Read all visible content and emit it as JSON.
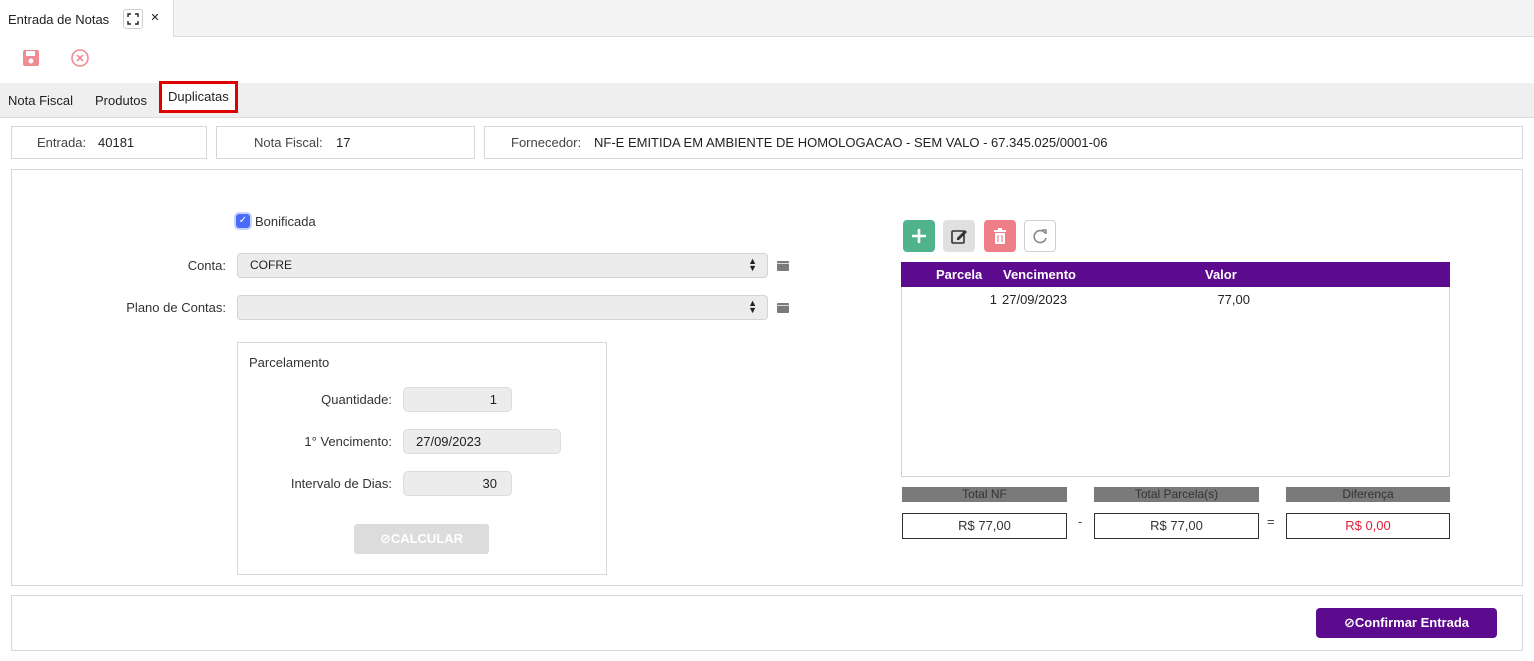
{
  "window_tab": {
    "title": "Entrada de Notas",
    "expand_glyph": "⛶",
    "close_glyph": "✕"
  },
  "toolbar": {
    "save_icon": "save-icon",
    "cancel_icon": "cancel-circle-icon"
  },
  "tabs": [
    {
      "label": "Nota Fiscal",
      "active": false
    },
    {
      "label": "Produtos",
      "active": false
    },
    {
      "label": "Duplicatas",
      "active": true
    }
  ],
  "header": {
    "entrada_label": "Entrada:",
    "entrada_value": "40181",
    "nota_label": "Nota Fiscal:",
    "nota_value": "17",
    "fornecedor_label": "Fornecedor:",
    "fornecedor_value": "NF-E EMITIDA EM AMBIENTE DE HOMOLOGACAO - SEM VALO - 67.345.025/0001-06"
  },
  "form": {
    "bonificada_label": "Bonificada",
    "bonificada_checked": true,
    "conta_label": "Conta:",
    "conta_value": "COFRE",
    "plano_label": "Plano de Contas:",
    "plano_value": ""
  },
  "parcelamento": {
    "title": "Parcelamento",
    "quantidade_label": "Quantidade:",
    "quantidade_value": "1",
    "vencimento_label": "1° Vencimento:",
    "vencimento_value": "27/09/2023",
    "intervalo_label": "Intervalo de Dias:",
    "intervalo_value": "30",
    "calcular_label": "⊘CALCULAR"
  },
  "grid": {
    "columns": [
      "Parcela",
      "Vencimento",
      "Valor"
    ],
    "rows": [
      {
        "parcela": "1",
        "vencimento": "27/09/2023",
        "valor": "77,00"
      }
    ]
  },
  "totals": {
    "total_nf_label": "Total NF",
    "total_nf_value": "R$ 77,00",
    "minus": "-",
    "total_parcelas_label": "Total Parcela(s)",
    "total_parcelas_value": "R$ 77,00",
    "equals": "=",
    "diferenca_label": "Diferença",
    "diferenca_value": "R$ 0,00"
  },
  "footer": {
    "confirm_label": "⊘Confirmar Entrada"
  },
  "colors": {
    "accent": "#5c0a8e",
    "add": "#4fb38c",
    "delete": "#ee7f89",
    "highlight_border": "#e00000",
    "diferenca_text": "#e0203a"
  }
}
